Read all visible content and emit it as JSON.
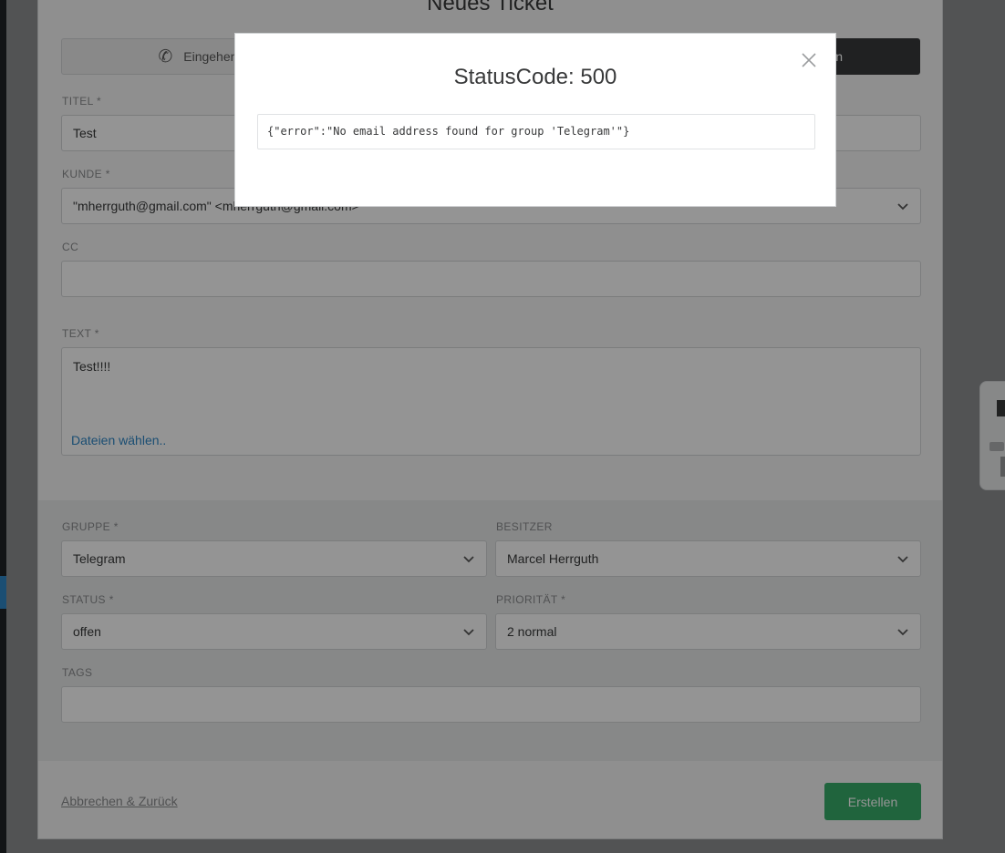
{
  "page": {
    "title": "Neues Ticket",
    "type_buttons": {
      "inbound_call": "Eingehender",
      "active_truncated": "n"
    },
    "fields": {
      "title_label": "TITEL *",
      "title_value": "Test",
      "customer_label": "KUNDE *",
      "customer_value": "\"mherrguth@gmail.com\" <mherrguth@gmail.com>",
      "cc_label": "CC",
      "cc_value": "",
      "text_label": "TEXT *",
      "text_value": "Test!!!!",
      "files_link": "Dateien wählen.."
    },
    "attributes": {
      "group_label": "GRUPPE *",
      "group_value": "Telegram",
      "owner_label": "BESITZER",
      "owner_value": "Marcel Herrguth",
      "state_label": "STATUS *",
      "state_value": "offen",
      "priority_label": "PRIORITÄT *",
      "priority_value": "2 normal",
      "tags_label": "TAGS",
      "tags_value": ""
    },
    "actions": {
      "cancel": "Abbrechen & Zurück",
      "create": "Erstellen"
    }
  },
  "modal": {
    "title": "StatusCode: 500",
    "body": "{\"error\":\"No email address found for group 'Telegram'\"}",
    "close_icon": "close-icon"
  },
  "colors": {
    "primary": "#2f87c6",
    "success": "#38ad69",
    "dark_button": "#383a3c"
  }
}
